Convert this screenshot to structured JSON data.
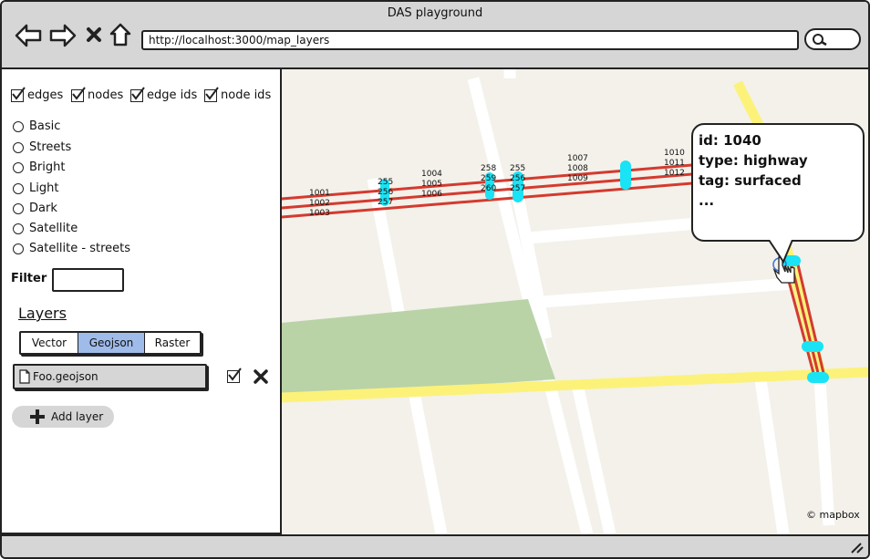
{
  "window": {
    "title": "DAS playground",
    "url": "http://localhost:3000/map_layers"
  },
  "nav_icons": [
    "back-arrow-icon",
    "forward-arrow-icon",
    "close-icon",
    "home-icon",
    "search-icon"
  ],
  "toggles": [
    {
      "label": "edges",
      "checked": true
    },
    {
      "label": "nodes",
      "checked": true
    },
    {
      "label": "edge ids",
      "checked": true
    },
    {
      "label": "node ids",
      "checked": true
    }
  ],
  "basemaps": [
    "Basic",
    "Streets",
    "Bright",
    "Light",
    "Dark",
    "Satellite",
    "Satellite - streets"
  ],
  "filter": {
    "label": "Filter",
    "value": ""
  },
  "layers": {
    "heading": "Layers",
    "tabs": [
      {
        "label": "Vector",
        "active": false
      },
      {
        "label": "Geojson",
        "active": true
      },
      {
        "label": "Raster",
        "active": false
      }
    ],
    "file": {
      "name": "Foo.geojson",
      "visible": true
    },
    "add_label": "Add layer"
  },
  "map": {
    "edge_labels": [
      "1001",
      "1002",
      "1003",
      "255",
      "256",
      "257",
      "1004",
      "1005",
      "1006",
      "258",
      "259",
      "260",
      "255",
      "256",
      "257",
      "1007",
      "1008",
      "1009",
      "1010",
      "1011",
      "1012"
    ],
    "attribution": "© mapbox",
    "tooltip": {
      "lines": [
        "id: 1040",
        "type: highway",
        "tag: surfaced",
        "..."
      ]
    }
  },
  "colors": {
    "edge": "#d43a2f",
    "node": "#19e3f5",
    "accent_tab": "#9fbbe9",
    "park": "#b9d3a7",
    "road_major": "#fcf27a"
  }
}
